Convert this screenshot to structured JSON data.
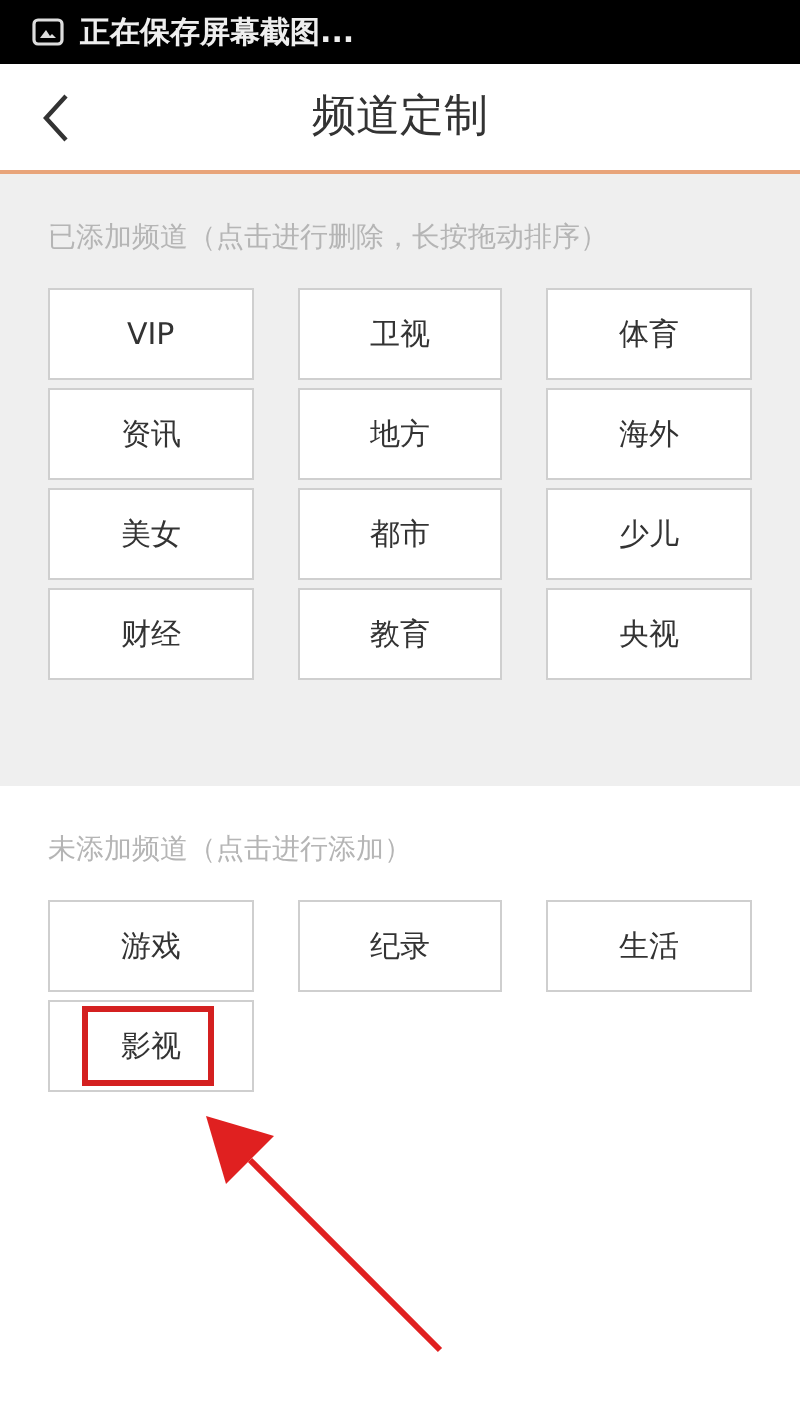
{
  "status_bar": {
    "notification": "正在保存屏幕截图..."
  },
  "header": {
    "title": "频道定制"
  },
  "added": {
    "label": "已添加频道（点击进行删除，长按拖动排序）",
    "channels": [
      {
        "label": "VIP"
      },
      {
        "label": "卫视"
      },
      {
        "label": "体育"
      },
      {
        "label": "资讯"
      },
      {
        "label": "地方"
      },
      {
        "label": "海外"
      },
      {
        "label": "美女"
      },
      {
        "label": "都市"
      },
      {
        "label": "少儿"
      },
      {
        "label": "财经"
      },
      {
        "label": "教育"
      },
      {
        "label": "央视"
      }
    ]
  },
  "not_added": {
    "label": "未添加频道（点击进行添加）",
    "channels": [
      {
        "label": "游戏",
        "highlighted": false
      },
      {
        "label": "纪录",
        "highlighted": false
      },
      {
        "label": "生活",
        "highlighted": false
      },
      {
        "label": "影视",
        "highlighted": true
      }
    ]
  }
}
